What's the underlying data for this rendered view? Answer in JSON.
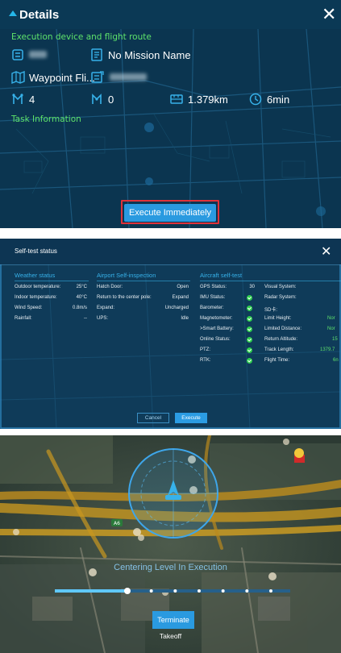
{
  "details": {
    "title": "Details",
    "close": "✕",
    "section_device": "Execution device and flight route",
    "mission_name": "No Mission Name",
    "route_type": "Waypoint Fli...",
    "waypoints": "4",
    "actions": "0",
    "distance": "1.379km",
    "duration": "6min",
    "section_task": "Task Information",
    "execute_label": "Execute Immediately"
  },
  "selftest": {
    "title": "Self-test status",
    "close": "✕",
    "weather": {
      "title": "Weather status",
      "rows": [
        {
          "label": "Outdoor temperature:",
          "value": "25°C"
        },
        {
          "label": "Indoor temperature:",
          "value": "40°C"
        },
        {
          "label": "Wind Speed:",
          "value": "0.8m/s"
        },
        {
          "label": "Rainfall:",
          "value": "--"
        }
      ]
    },
    "airport": {
      "title": "Airport Self-inspection",
      "rows": [
        {
          "label": "Hatch Door:",
          "value": "Open"
        },
        {
          "label": "Return to the center pole:",
          "value": "Expand"
        },
        {
          "label": "Expand:",
          "value": "Uncharged"
        },
        {
          "label": "UPS:",
          "value": "Idle"
        }
      ]
    },
    "aircraft": {
      "title": "Aircraft self-test",
      "left_rows": [
        {
          "label": "GPS Status:",
          "value": "30"
        },
        {
          "label": "IMU Status:",
          "value": ""
        },
        {
          "label": "Barometer:",
          "value": ""
        },
        {
          "label": "Magnetometer:",
          "value": ""
        },
        {
          "label": ">Smart Battery:",
          "value": ""
        },
        {
          "label": "Online Status:",
          "value": ""
        },
        {
          "label": "PTZ:",
          "value": ""
        },
        {
          "label": "RTK:",
          "value": ""
        }
      ],
      "right_rows": [
        {
          "label": "Visual System:",
          "value": ""
        },
        {
          "label": "Radar System:",
          "value": ""
        },
        {
          "label": "SD卡:",
          "value": ""
        },
        {
          "label": "Limit Height:",
          "value": "Nor"
        },
        {
          "label": "Limited Distance:",
          "value": "Nor"
        },
        {
          "label": "Return Altitude:",
          "value": "15"
        },
        {
          "label": "Track Length:",
          "value": "1379.7"
        },
        {
          "label": "Flight Time:",
          "value": "6n"
        }
      ]
    },
    "cancel_label": "Cancel",
    "execute_label": "Execute"
  },
  "flight": {
    "status_text": "Centering Level In Execution",
    "terminate_label": "Terminate",
    "takeoff_label": "Takeoff",
    "progress_fraction": 0.3,
    "checkpoints": 7,
    "map_label": "A6"
  },
  "colors": {
    "accent": "#2a9ae0",
    "highlight_border": "#e0323a",
    "section_green": "#5ee36a",
    "title_blue": "#37b2ea",
    "ok_green": "#2fcf4e"
  }
}
